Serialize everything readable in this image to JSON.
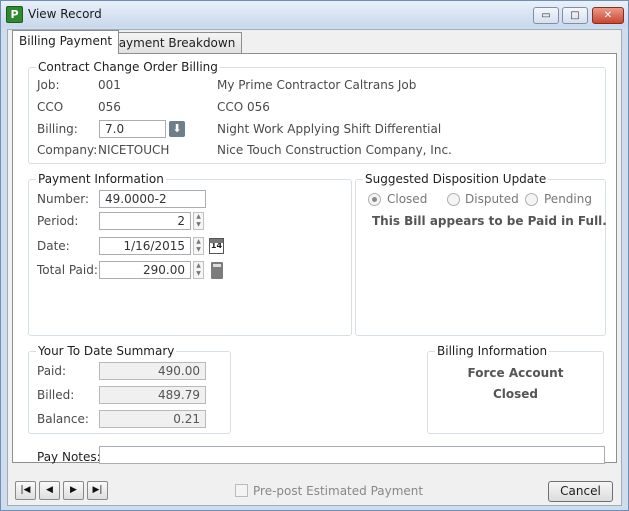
{
  "window": {
    "title": "View Record",
    "app_icon_letter": "P",
    "min_glyph": "▭",
    "max_glyph": "□",
    "close_glyph": "✕"
  },
  "tabs": [
    {
      "label": "Billing Payment",
      "active": true
    },
    {
      "label": "Payment Breakdown",
      "active": false
    }
  ],
  "contract": {
    "legend": "Contract Change Order Billing",
    "job_label": "Job:",
    "job_value": "001",
    "job_name": "My Prime Contractor Caltrans Job",
    "cco_label": "CCO",
    "cco_value": "056",
    "cco_name": "CCO 056",
    "billing_label": "Billing:",
    "billing_value": "7.0",
    "billing_desc": "Night Work Applying Shift Differential",
    "company_label": "Company:",
    "company_value": "NICETOUCH",
    "company_name": "Nice Touch Construction Company, Inc."
  },
  "payment": {
    "legend": "Payment Information",
    "number_label": "Number:",
    "number_value": "49.0000-2",
    "period_label": "Period:",
    "period_value": "2",
    "date_label": "Date:",
    "date_value": "1/16/2015",
    "calendar_day": "14",
    "total_label": "Total Paid:",
    "total_value": "290.00"
  },
  "disposition": {
    "legend": "Suggested Disposition Update",
    "options": [
      {
        "label": "Closed",
        "selected": true
      },
      {
        "label": "Disputed",
        "selected": false
      },
      {
        "label": "Pending",
        "selected": false
      }
    ],
    "message": "This Bill appears to be Paid in Full."
  },
  "summary": {
    "legend": "Your To Date Summary",
    "paid_label": "Paid:",
    "paid_value": "490.00",
    "billed_label": "Billed:",
    "billed_value": "489.79",
    "balance_label": "Balance:",
    "balance_value": "0.21"
  },
  "billing_info": {
    "legend": "Billing Information",
    "line1": "Force Account",
    "line2": "Closed"
  },
  "notes": {
    "label": "Pay Notes:",
    "value": ""
  },
  "footer": {
    "nav_first": "|◀",
    "nav_prev": "◀",
    "nav_next": "▶",
    "nav_last": "▶|",
    "prepost_label": "Pre-post Estimated Payment",
    "prepost_checked": false,
    "cancel_label": "Cancel"
  },
  "colors": {
    "window_frame": "#cfdcec",
    "close_button": "#c8462f",
    "app_icon": "#2f8a2f"
  }
}
